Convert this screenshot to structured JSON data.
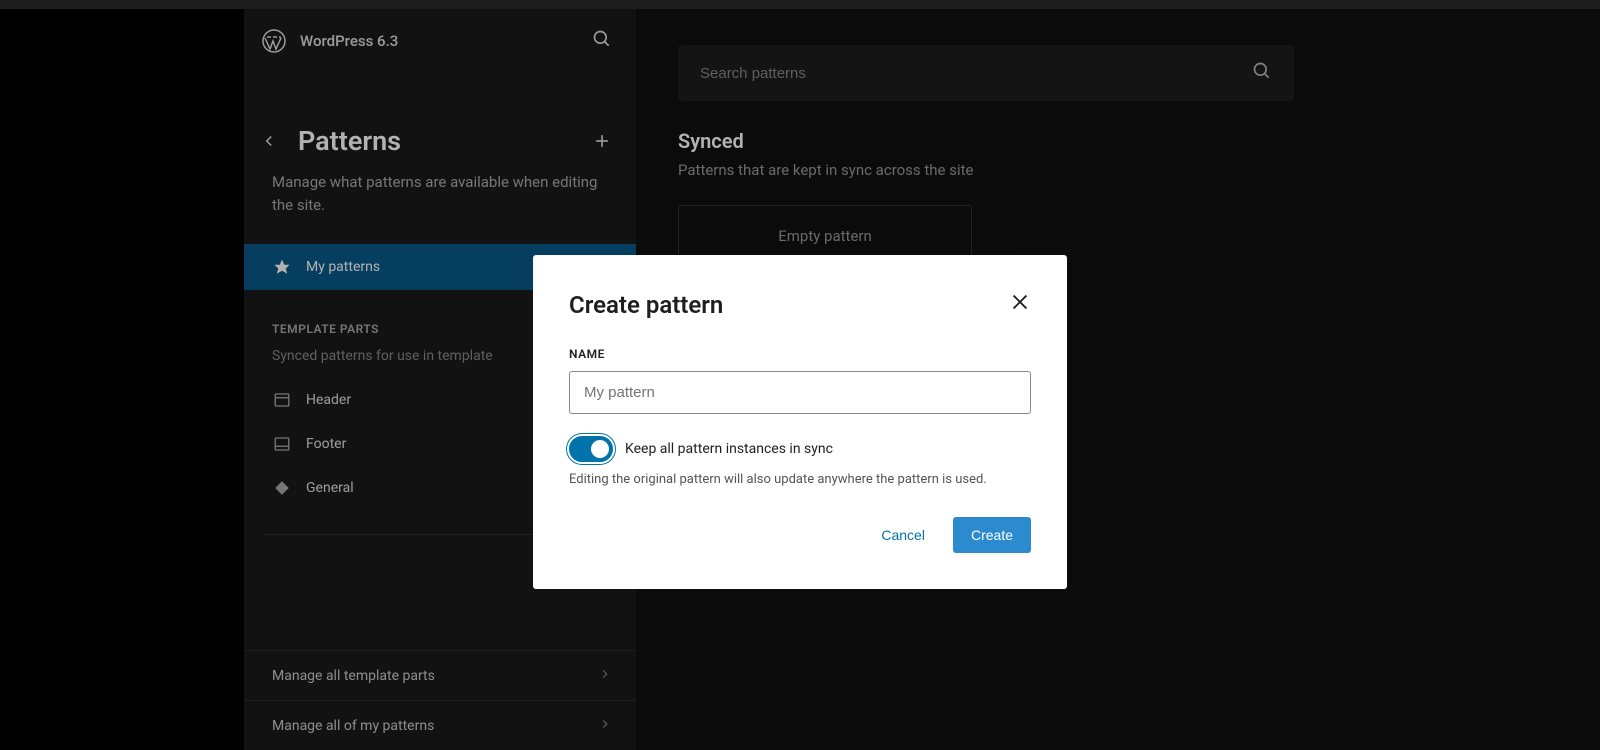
{
  "header": {
    "site_title": "WordPress 6.3"
  },
  "sidebar": {
    "title": "Patterns",
    "description": "Manage what patterns are available when editing the site.",
    "my_patterns_label": "My patterns",
    "template_parts_header": "TEMPLATE PARTS",
    "template_parts_desc": "Synced patterns for use in template",
    "template_items": [
      {
        "label": "Header"
      },
      {
        "label": "Footer"
      },
      {
        "label": "General"
      }
    ],
    "manage_items": [
      {
        "label": "Manage all template parts"
      },
      {
        "label": "Manage all of my patterns"
      }
    ]
  },
  "main": {
    "search_placeholder": "Search patterns",
    "synced_heading": "Synced",
    "synced_desc": "Patterns that are kept in sync across the site",
    "empty_pattern_label": "Empty pattern"
  },
  "modal": {
    "title": "Create pattern",
    "name_label": "NAME",
    "name_placeholder": "My pattern",
    "toggle_label": "Keep all pattern instances in sync",
    "toggle_help": "Editing the original pattern will also update anywhere the pattern is used.",
    "cancel_label": "Cancel",
    "create_label": "Create"
  }
}
